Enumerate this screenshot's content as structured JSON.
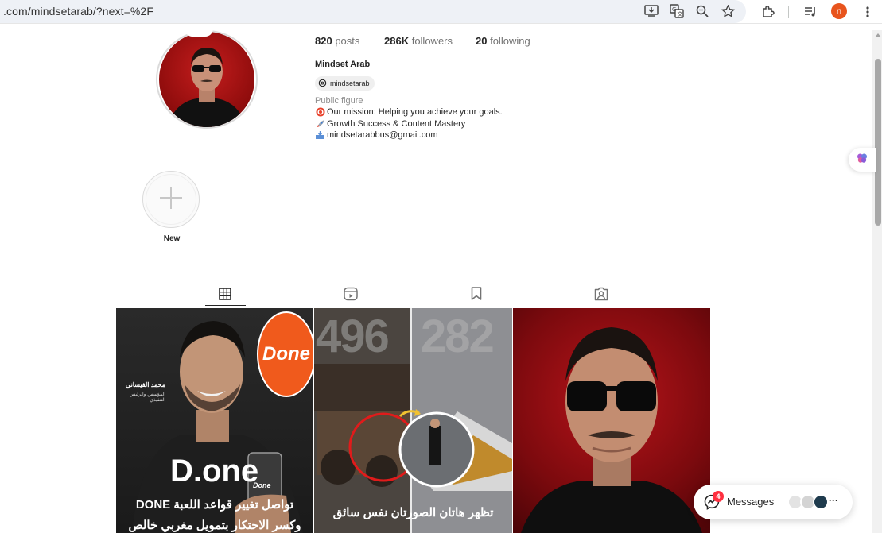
{
  "browser": {
    "url": ".com/mindsetarab/?next=%2F",
    "profile_initial": "n"
  },
  "profile": {
    "stats": {
      "posts_count": "820",
      "posts_label": "posts",
      "followers_count": "286K",
      "followers_label": "followers",
      "following_count": "20",
      "following_label": "following"
    },
    "full_name": "Mindset Arab",
    "threads_handle": "mindsetarab",
    "category": "Public figure",
    "bio": [
      "Our mission: Helping you achieve your goals.",
      "Growth Success & Content Mastery",
      "mindsetarabbus@gmail.com"
    ]
  },
  "highlights": {
    "new_label": "New"
  },
  "tabs": [
    "posts-grid",
    "reels",
    "saved",
    "tagged"
  ],
  "posts": [
    {
      "logo_text": "Done",
      "person_name": "محمد الفيساني",
      "person_role": "المؤسس والرئيس التنفيذي",
      "phone_logo": "Done",
      "big_logo": "D.one",
      "caption_line1": "تواصل تغيير قواعد اللعبة DONE",
      "caption_line2": "وكسر الاحتكار بتمويل مغربي خالص"
    },
    {
      "number_left": "496",
      "number_right": "282",
      "caption_line1": "تظهر هاتان الصورتان نفس سائق",
      "caption_line2": ""
    },
    {}
  ],
  "messages": {
    "label": "Messages",
    "badge": "4",
    "more": "···"
  },
  "colors": {
    "accent_orange": "#e8541d",
    "badge_red": "#ff3040",
    "done_orange": "#f05a1c"
  }
}
